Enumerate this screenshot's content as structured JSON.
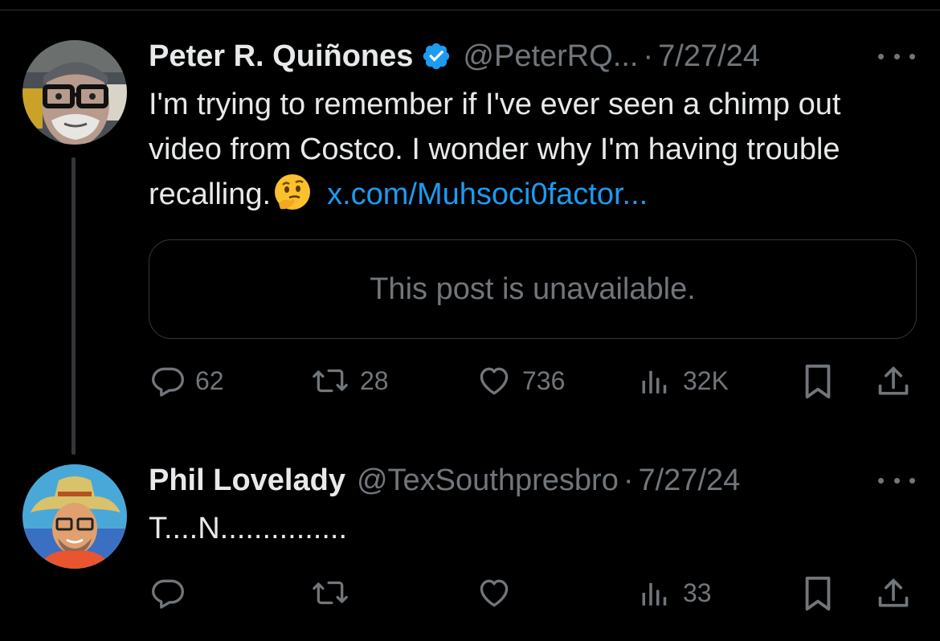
{
  "tweets": [
    {
      "author_name": "Peter R. Quiñones",
      "verified": true,
      "handle": "@PeterRQ...",
      "separator": "·",
      "date": "7/27/24",
      "text_before": "I'm trying to remember if I've ever seen a chimp out video from Costco. I wonder why I'm having trouble recalling.",
      "emoji": "thinking-face",
      "link_text": "x.com/Muhsoci0factor...",
      "quote_text": "This post is unavailable.",
      "actions": {
        "replies": "62",
        "reposts": "28",
        "likes": "736",
        "views": "32K"
      }
    },
    {
      "author_name": "Phil Lovelady",
      "verified": false,
      "handle": "@TexSouthpresbro",
      "separator": "·",
      "date": "7/27/24",
      "text": "T....N...............",
      "actions": {
        "replies": "",
        "reposts": "",
        "likes": "",
        "views": "33"
      }
    }
  ],
  "colors": {
    "background": "#000000",
    "text_primary": "#e7e9ea",
    "text_secondary": "#71767b",
    "link": "#1d9bf0",
    "verified_badge": "#1d9bf0",
    "border": "#333639"
  },
  "icons": [
    "reply-icon",
    "repost-icon",
    "like-icon",
    "views-icon",
    "bookmark-icon",
    "share-icon",
    "more-icon",
    "verified-badge-icon"
  ]
}
